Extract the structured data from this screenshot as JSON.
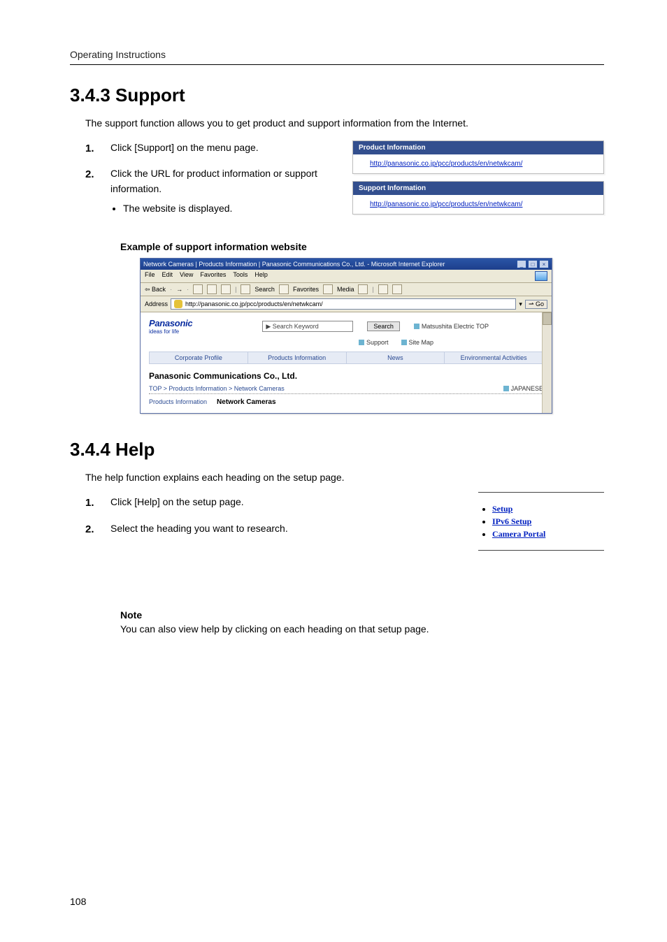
{
  "running_header": "Operating Instructions",
  "page_number": "108",
  "s343": {
    "heading": "3.4.3    Support",
    "intro": "The support function allows you to get product and support information from the Internet.",
    "steps": [
      {
        "num": "1.",
        "text": "Click [Support] on the menu page."
      },
      {
        "num": "2.",
        "text": "Click the URL for product information or support information.",
        "sub": [
          "The website is displayed."
        ]
      }
    ],
    "product_info_title": "Product Information",
    "product_info_url": "http://panasonic.co.jp/pcc/products/en/netwkcam/",
    "support_info_title": "Support Information",
    "support_info_url": "http://panasonic.co.jp/pcc/products/en/netwkcam/",
    "example_label": "Example of support information website"
  },
  "ie": {
    "title": "Network Cameras | Products Information | Panasonic Communications Co., Ltd. - Microsoft Internet Explorer",
    "menus": [
      "File",
      "Edit",
      "View",
      "Favorites",
      "Tools",
      "Help"
    ],
    "toolbar": {
      "back": "Back",
      "search": "Search",
      "favorites": "Favorites",
      "media": "Media"
    },
    "address_label": "Address",
    "address_url": "http://panasonic.co.jp/pcc/products/en/netwkcam/",
    "go": "Go",
    "brand": "Panasonic",
    "brand_sub": "ideas for life",
    "search_placeholder": "▶ Search Keyword",
    "search_btn": "Search",
    "top_link": "Matsushita Electric TOP",
    "support_link": "Support",
    "sitemap_link": "Site Map",
    "tabs": [
      "Corporate Profile",
      "Products Information",
      "News",
      "Environmental Activities"
    ],
    "corp": "Panasonic Communications Co., Ltd.",
    "crumb": "TOP > Products Information > Network Cameras",
    "japanese": "JAPANESE",
    "prod_line": {
      "left": "Products Information",
      "right": "Network Cameras"
    }
  },
  "s344": {
    "heading": "3.4.4    Help",
    "intro": "The help function explains each heading on the setup page.",
    "steps": [
      {
        "num": "1.",
        "text": "Click [Help] on the setup page."
      },
      {
        "num": "2.",
        "text": "Select the heading you want to research."
      }
    ],
    "links": [
      "Setup",
      "IPv6 Setup",
      "Camera Portal"
    ],
    "note_title": "Note",
    "note_text": "You can also view help by clicking on each heading on that setup page."
  }
}
